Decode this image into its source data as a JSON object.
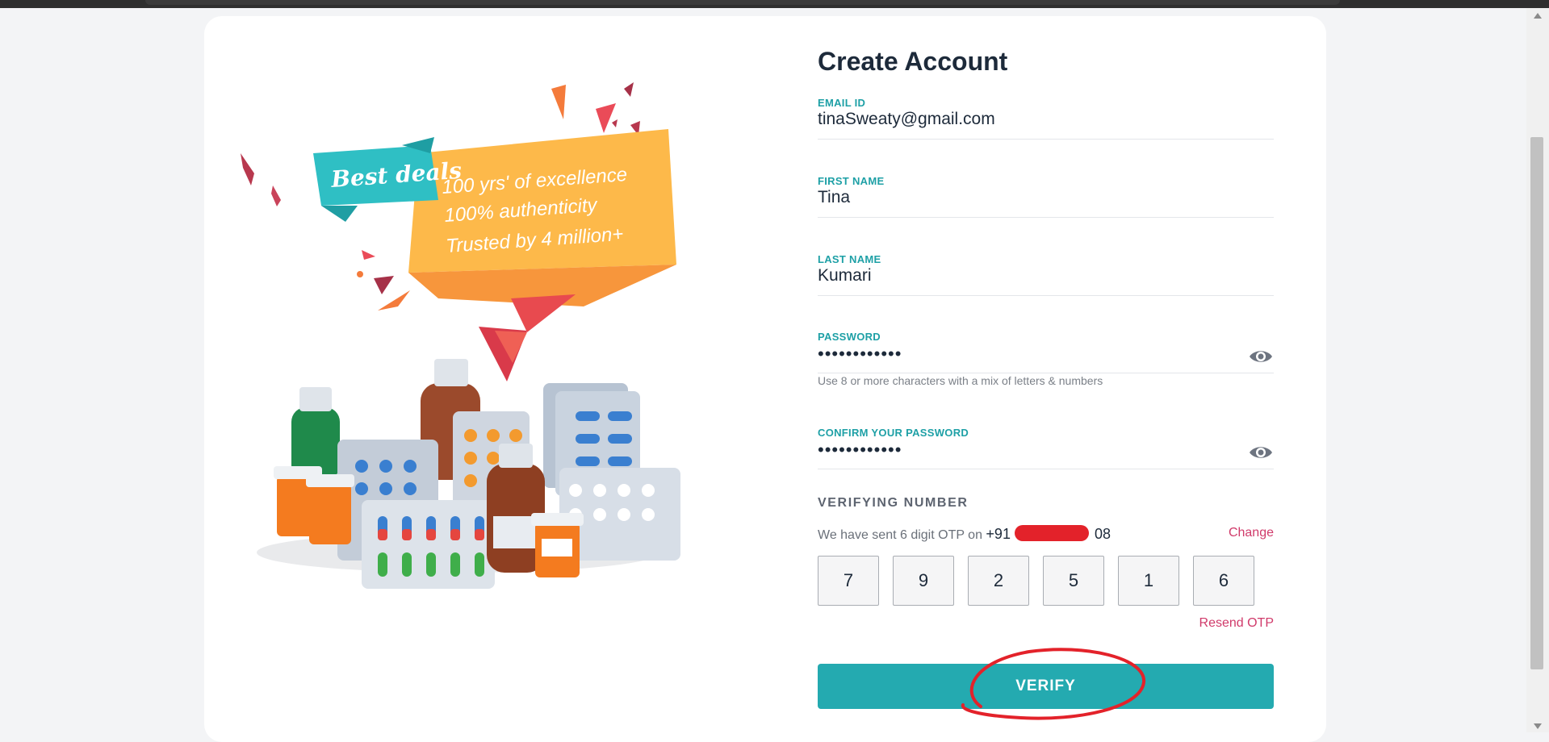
{
  "form": {
    "title": "Create Account",
    "email": {
      "label": "EMAIL ID",
      "value": "tinaSweaty@gmail.com"
    },
    "first_name": {
      "label": "FIRST NAME",
      "value": "Tina"
    },
    "last_name": {
      "label": "LAST NAME",
      "value": "Kumari"
    },
    "password": {
      "label": "PASSWORD",
      "masked": "••••••••••••",
      "hint": "Use 8 or more characters with a mix of letters & numbers"
    },
    "confirm_password": {
      "label": "CONFIRM YOUR PASSWORD",
      "masked": "••••••••••••"
    }
  },
  "verification": {
    "title": "VERIFYING NUMBER",
    "message": "We have sent 6 digit OTP on",
    "phone_prefix": "+91",
    "phone_suffix": "08",
    "change_label": "Change",
    "otp_digits": [
      "7",
      "9",
      "2",
      "5",
      "1",
      "6"
    ],
    "resend_label": "Resend OTP",
    "verify_label": "VERIFY"
  },
  "banner": {
    "tag": "Best deals",
    "lines": [
      "100 yrs' of excellence",
      "100% authenticity",
      "Trusted by 4 million+"
    ]
  },
  "colors": {
    "accent": "#24aab0",
    "label": "#1ea0a6",
    "link": "#d03a6a",
    "heading": "#1d2a3a",
    "annotation": "#e3222a"
  },
  "icons": {
    "password_toggle": "eye-icon"
  }
}
